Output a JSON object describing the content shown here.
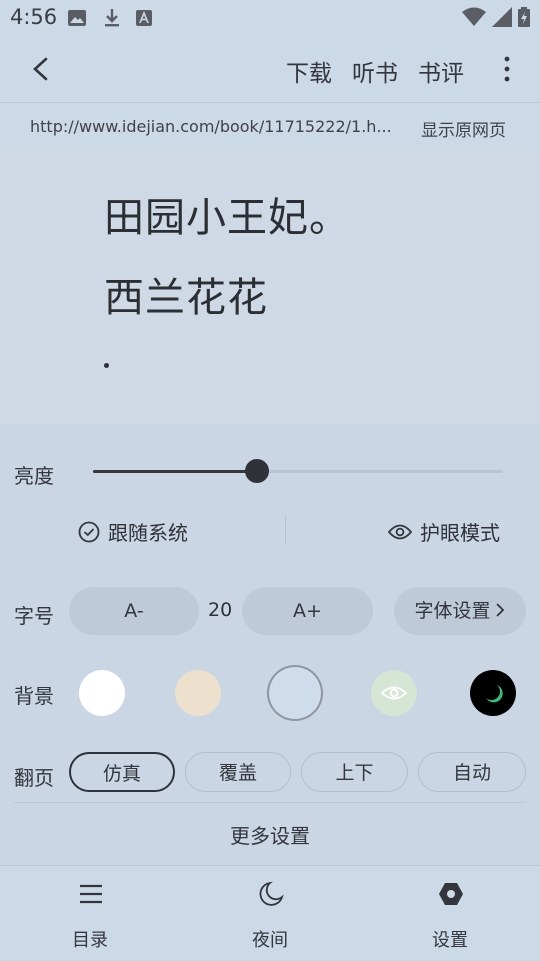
{
  "status_bar": {
    "time": "4:56",
    "icons": [
      "image-icon",
      "download-icon",
      "text-a-icon",
      "wifi-icon",
      "signal-icon",
      "battery-icon"
    ]
  },
  "top_bar": {
    "download": "下载",
    "listen": "听书",
    "review": "书评"
  },
  "url_bar": {
    "url": "http://www.idejian.com/book/11715222/1.h...",
    "show_original": "显示原网页"
  },
  "content": {
    "title": "田园小王妃。",
    "author": "西兰花花"
  },
  "settings": {
    "brightness_label": "亮度",
    "brightness_level": 0.4,
    "follow_system": "跟随系统",
    "eye_mode": "护眼模式",
    "font_label": "字号",
    "font_minus": "A-",
    "font_size": "20",
    "font_plus": "A+",
    "font_settings": "字体设置",
    "bg_label": "背景",
    "bg_colors": [
      "#ffffff",
      "#ede0cc",
      "#cfdcec",
      "#d6e6d4",
      "#000000"
    ],
    "selected_bg_index": 2,
    "turn_label": "翻页",
    "turn_modes": [
      "仿真",
      "覆盖",
      "上下",
      "自动"
    ],
    "selected_turn_index": 0,
    "more_settings": "更多设置"
  },
  "bottom_nav": {
    "toc": "目录",
    "night": "夜间",
    "settings": "设置"
  }
}
